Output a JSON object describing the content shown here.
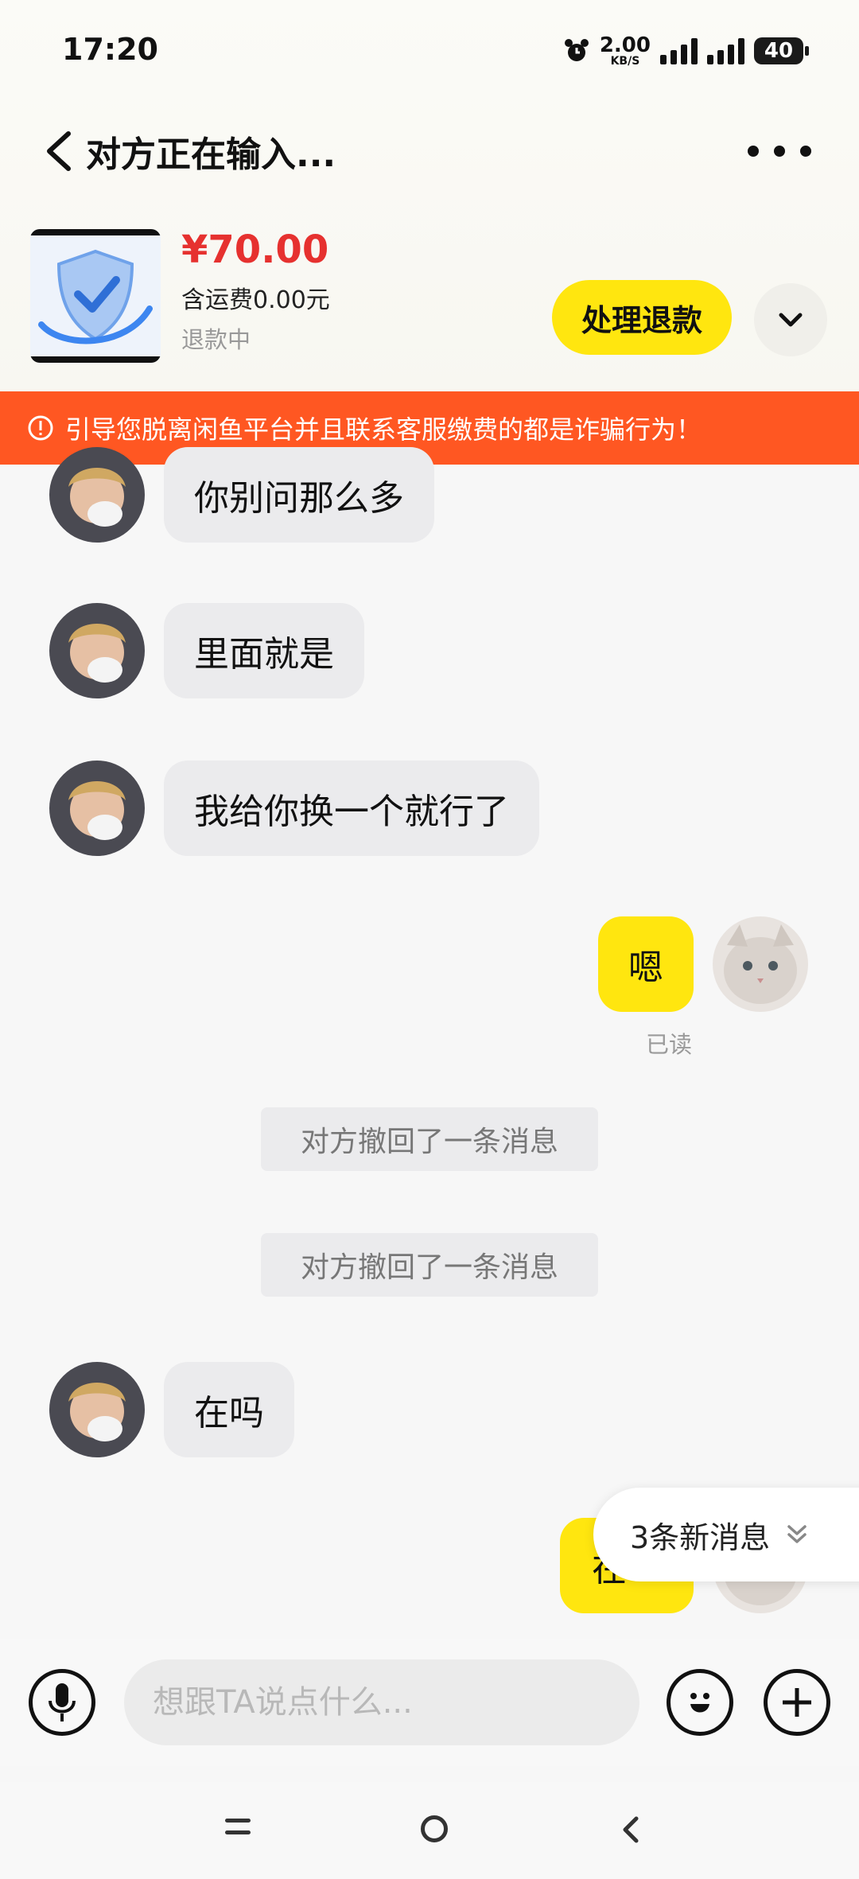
{
  "status_bar": {
    "time": "17:20",
    "net_speed": "2.00",
    "net_unit": "KB/S",
    "battery": "40"
  },
  "header": {
    "title": "对方正在输入..."
  },
  "product": {
    "price": "¥70.00",
    "shipping": "含运费0.00元",
    "status": "退款中",
    "action_label": "处理退款"
  },
  "warning": {
    "text": "引导您脱离闲鱼平台并且联系客服缴费的都是诈骗行为！"
  },
  "messages": [
    {
      "from": "other",
      "text": "你别问那么多"
    },
    {
      "from": "other",
      "text": "里面就是"
    },
    {
      "from": "other",
      "text": "我给你换一个就行了"
    },
    {
      "from": "me",
      "text": "嗯",
      "receipt": "已读"
    },
    {
      "from": "system",
      "text": "对方撤回了一条消息"
    },
    {
      "from": "system",
      "text": "对方撤回了一条消息"
    },
    {
      "from": "other",
      "text": "在吗"
    },
    {
      "from": "me",
      "text": "在？"
    }
  ],
  "new_messages": {
    "label": "3条新消息"
  },
  "input": {
    "placeholder": "想跟TA说点什么..."
  },
  "colors": {
    "accent_yellow": "#ffe60f",
    "price_red": "#e6312f",
    "warning_orange": "#ff5722"
  }
}
